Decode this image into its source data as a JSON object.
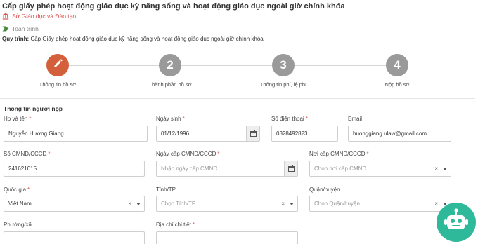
{
  "page": {
    "title": "Cấp giấy phép hoạt động giáo dục kỹ năng sống và hoạt động giáo dục ngoài giờ chính khóa",
    "org": "Sở Giáo dục và Đào tạo",
    "status": "Toàn trình",
    "process_label": "Quy trình:",
    "process_value": "Cấp Giấy phép hoạt động giáo dục kỹ năng sống và hoạt động giáo dục ngoài giờ chính khóa"
  },
  "icons": {
    "org": "building-icon",
    "status": "chevron-tag-icon",
    "step1": "pencil-icon",
    "calendar": "calendar-icon",
    "chatbot": "robot-icon"
  },
  "colors": {
    "accent": "#d45f3b",
    "step_inactive": "#9a9a9a",
    "org_text": "#d9534f",
    "status_icon": "#4a8a3a",
    "required": "#d9534f",
    "chatbot_bg": "#2db99a"
  },
  "steps": [
    {
      "label": "Thông tin hồ sơ",
      "number": "",
      "active": true
    },
    {
      "label": "Thành phần hồ sơ",
      "number": "2",
      "active": false
    },
    {
      "label": "Thông tin phí, lệ phí",
      "number": "3",
      "active": false
    },
    {
      "label": "Nộp hồ sơ",
      "number": "4",
      "active": false
    }
  ],
  "form": {
    "section_title": "Thông tin người nộp",
    "fields": {
      "name": {
        "label": "Họ và tên",
        "required": "*",
        "value": "Nguyễn Hương Giang"
      },
      "dob": {
        "label": "Ngày sinh",
        "required": "*",
        "value": "01/12/1996"
      },
      "phone": {
        "label": "Số điện thoại",
        "required": "*",
        "value": "0328492823"
      },
      "email": {
        "label": "Email",
        "required": "",
        "value": "huonggiang.ulaw@gmail.com"
      },
      "id_number": {
        "label": "Số CMND/CCCD",
        "required": "*",
        "value": "241621015"
      },
      "id_date": {
        "label": "Ngày cấp CMND/CCCD",
        "required": "*",
        "placeholder": "Nhập ngày cấp CMND"
      },
      "id_place": {
        "label": "Nơi cấp CMND/CCCD",
        "required": "*",
        "placeholder": "Chọn nơi cấp CMND"
      },
      "country": {
        "label": "Quốc gia",
        "required": "*",
        "value": "Việt Nam"
      },
      "province": {
        "label": "Tỉnh/TP",
        "required": "",
        "placeholder": "Chọn Tỉnh/TP"
      },
      "district": {
        "label": "Quận/huyện",
        "required": "",
        "placeholder": "Chọn Quận/huyện"
      },
      "ward": {
        "label": "Phường/xã",
        "required": ""
      },
      "address": {
        "label": "Địa chỉ chi tiết",
        "required": "*"
      }
    },
    "clear_glyph": "×"
  }
}
